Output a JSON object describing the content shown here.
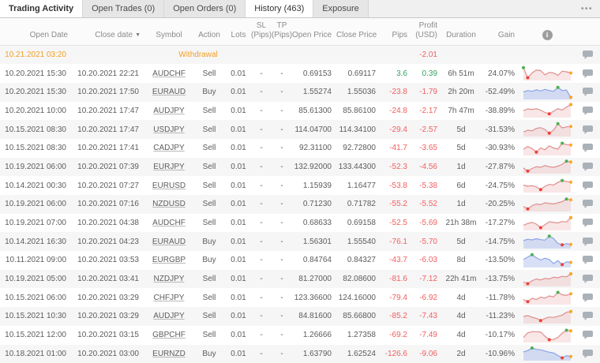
{
  "tabs": [
    {
      "label": "Trading Activity",
      "variant": "title",
      "active": false
    },
    {
      "label": "Open Trades (0)",
      "active": false
    },
    {
      "label": "Open Orders (0)",
      "active": false
    },
    {
      "label": "History (463)",
      "active": true
    },
    {
      "label": "Exposure",
      "active": false
    }
  ],
  "menu_icon": "ellipsis-menu",
  "header_info_icon": "i",
  "columns": [
    {
      "key": "open_date",
      "label": "Open Date",
      "width": 92,
      "align": "r"
    },
    {
      "key": "close_date",
      "label": "Close date",
      "width": 92,
      "align": "r",
      "sorted": "desc",
      "sort_glyph": "▼"
    },
    {
      "key": "symbol",
      "label": "Symbol",
      "width": 60,
      "align": "c"
    },
    {
      "key": "action",
      "label": "Action",
      "width": 42,
      "align": "c"
    },
    {
      "key": "lots",
      "label": "Lots",
      "width": 32,
      "align": "c"
    },
    {
      "key": "sl",
      "label": "SL",
      "label2": "(Pips)",
      "width": 26,
      "align": "c"
    },
    {
      "key": "tp",
      "label": "TP",
      "label2": "(Pips)",
      "width": 26,
      "align": "c"
    },
    {
      "key": "open_price",
      "label": "Open Price",
      "width": 56,
      "align": "r"
    },
    {
      "key": "close_price",
      "label": "Close Price",
      "width": 56,
      "align": "r"
    },
    {
      "key": "pips",
      "label": "Pips",
      "width": 40,
      "align": "r"
    },
    {
      "key": "profit",
      "label": "Profit",
      "label2": "(USD)",
      "width": 38,
      "align": "r"
    },
    {
      "key": "duration",
      "label": "Duration",
      "width": 48,
      "align": "c"
    },
    {
      "key": "gain",
      "label": "Gain",
      "width": 50,
      "align": "r"
    },
    {
      "key": "chart",
      "label": "",
      "width": 70,
      "align": "c",
      "icon": "info"
    },
    {
      "key": "comment",
      "label": "",
      "width": 32,
      "align": "c"
    }
  ],
  "rows": [
    {
      "type": "withdrawal",
      "open_date": "10.21.2021 03:20",
      "label": "Withdrawal",
      "profit": "-2.01"
    },
    {
      "open_date": "10.20.2021 15:30",
      "close_date": "10.20.2021 22:21",
      "symbol": "AUDCHF",
      "action": "Sell",
      "lots": "0.01",
      "sl": "-",
      "tp": "-",
      "open_price": "0.69153",
      "close_price": "0.69117",
      "pips": "3.6",
      "profit": "0.39",
      "duration": "6h 51m",
      "gain": "24.07%",
      "spark": {
        "color": "red",
        "values": [
          0.95,
          0.1,
          0.5,
          0.75,
          0.7,
          0.35,
          0.55,
          0.5,
          0.3,
          0.65,
          0.6,
          0.5
        ]
      }
    },
    {
      "open_date": "10.20.2021 15:30",
      "close_date": "10.20.2021 17:50",
      "symbol": "EURAUD",
      "action": "Buy",
      "lots": "0.01",
      "sl": "-",
      "tp": "-",
      "open_price": "1.55274",
      "close_price": "1.55036",
      "pips": "-23.8",
      "profit": "-1.79",
      "duration": "2h 20m",
      "gain": "-52.49%",
      "spark": {
        "color": "blue",
        "values": [
          0.5,
          0.62,
          0.55,
          0.68,
          0.58,
          0.72,
          0.62,
          0.55,
          0.88,
          0.62,
          0.66,
          0.04
        ]
      }
    },
    {
      "open_date": "10.20.2021 10:00",
      "close_date": "10.20.2021 17:47",
      "symbol": "AUDJPY",
      "action": "Sell",
      "lots": "0.01",
      "sl": "-",
      "tp": "-",
      "open_price": "85.61300",
      "close_price": "85.86100",
      "pips": "-24.8",
      "profit": "-2.17",
      "duration": "7h 47m",
      "gain": "-38.89%",
      "spark": {
        "color": "red",
        "values": [
          0.45,
          0.6,
          0.55,
          0.62,
          0.5,
          0.3,
          0.18,
          0.4,
          0.62,
          0.5,
          0.75,
          0.97
        ]
      }
    },
    {
      "open_date": "10.15.2021 08:30",
      "close_date": "10.20.2021 17:47",
      "symbol": "USDJPY",
      "action": "Sell",
      "lots": "0.01",
      "sl": "-",
      "tp": "-",
      "open_price": "114.04700",
      "close_price": "114.34100",
      "pips": "-29.4",
      "profit": "-2.57",
      "duration": "5d",
      "gain": "-31.53%",
      "spark": {
        "color": "red",
        "values": [
          0.25,
          0.4,
          0.35,
          0.55,
          0.62,
          0.45,
          0.15,
          0.4,
          0.95,
          0.6,
          0.68,
          0.72
        ]
      }
    },
    {
      "open_date": "10.15.2021 08:30",
      "close_date": "10.20.2021 17:41",
      "symbol": "CADJPY",
      "action": "Sell",
      "lots": "0.01",
      "sl": "-",
      "tp": "-",
      "open_price": "92.31100",
      "close_price": "92.72800",
      "pips": "-41.7",
      "profit": "-3.65",
      "duration": "5d",
      "gain": "-30.93%",
      "spark": {
        "color": "red",
        "values": [
          0.4,
          0.62,
          0.45,
          0.15,
          0.5,
          0.35,
          0.68,
          0.5,
          0.4,
          0.9,
          0.78,
          0.75
        ]
      }
    },
    {
      "open_date": "10.19.2021 06:00",
      "close_date": "10.20.2021 07:39",
      "symbol": "EURJPY",
      "action": "Sell",
      "lots": "0.01",
      "sl": "-",
      "tp": "-",
      "open_price": "132.92000",
      "close_price": "133.44300",
      "pips": "-52.3",
      "profit": "-4.56",
      "duration": "1d",
      "gain": "-27.87%",
      "spark": {
        "color": "red",
        "values": [
          0.35,
          0.08,
          0.3,
          0.45,
          0.4,
          0.55,
          0.45,
          0.4,
          0.5,
          0.65,
          0.92,
          0.85
        ]
      }
    },
    {
      "open_date": "10.14.2021 00:30",
      "close_date": "10.20.2021 07:27",
      "symbol": "EURUSD",
      "action": "Sell",
      "lots": "0.01",
      "sl": "-",
      "tp": "-",
      "open_price": "1.15939",
      "close_price": "1.16477",
      "pips": "-53.8",
      "profit": "-5.38",
      "duration": "6d",
      "gain": "-24.75%",
      "spark": {
        "color": "red",
        "values": [
          0.5,
          0.4,
          0.45,
          0.35,
          0.12,
          0.4,
          0.55,
          0.5,
          0.72,
          0.88,
          0.8,
          0.75
        ]
      }
    },
    {
      "open_date": "10.19.2021 06:00",
      "close_date": "10.20.2021 07:16",
      "symbol": "NZDUSD",
      "action": "Sell",
      "lots": "0.01",
      "sl": "-",
      "tp": "-",
      "open_price": "0.71230",
      "close_price": "0.71782",
      "pips": "-55.2",
      "profit": "-5.52",
      "duration": "1d",
      "gain": "-20.25%",
      "spark": {
        "color": "red",
        "values": [
          0.3,
          0.08,
          0.35,
          0.5,
          0.45,
          0.6,
          0.55,
          0.5,
          0.6,
          0.7,
          0.92,
          0.85
        ]
      }
    },
    {
      "open_date": "10.19.2021 07:00",
      "close_date": "10.20.2021 04:38",
      "symbol": "AUDCHF",
      "action": "Sell",
      "lots": "0.01",
      "sl": "-",
      "tp": "-",
      "open_price": "0.68633",
      "close_price": "0.69158",
      "pips": "-52.5",
      "profit": "-5.69",
      "duration": "21h 38m",
      "gain": "-17.27%",
      "spark": {
        "color": "red",
        "values": [
          0.3,
          0.45,
          0.55,
          0.4,
          0.1,
          0.35,
          0.6,
          0.55,
          0.5,
          0.62,
          0.58,
          0.95
        ]
      }
    },
    {
      "open_date": "10.14.2021 16:30",
      "close_date": "10.20.2021 04:23",
      "symbol": "EURAUD",
      "action": "Buy",
      "lots": "0.01",
      "sl": "-",
      "tp": "-",
      "open_price": "1.56301",
      "close_price": "1.55540",
      "pips": "-76.1",
      "profit": "-5.70",
      "duration": "5d",
      "gain": "-14.75%",
      "spark": {
        "color": "blue",
        "values": [
          0.55,
          0.65,
          0.6,
          0.7,
          0.62,
          0.58,
          0.92,
          0.72,
          0.3,
          0.18,
          0.28,
          0.22
        ]
      }
    },
    {
      "open_date": "10.11.2021 09:00",
      "close_date": "10.20.2021 03:53",
      "symbol": "EURGBP",
      "action": "Buy",
      "lots": "0.01",
      "sl": "-",
      "tp": "-",
      "open_price": "0.84764",
      "close_price": "0.84327",
      "pips": "-43.7",
      "profit": "-6.03",
      "duration": "8d",
      "gain": "-13.50%",
      "spark": {
        "color": "blue",
        "values": [
          0.55,
          0.75,
          0.95,
          0.7,
          0.5,
          0.65,
          0.55,
          0.2,
          0.45,
          0.12,
          0.35,
          0.3
        ]
      }
    },
    {
      "open_date": "10.19.2021 05:00",
      "close_date": "10.20.2021 03:41",
      "symbol": "NZDJPY",
      "action": "Sell",
      "lots": "0.01",
      "sl": "-",
      "tp": "-",
      "open_price": "81.27000",
      "close_price": "82.08600",
      "pips": "-81.6",
      "profit": "-7.12",
      "duration": "22h 41m",
      "gain": "-13.75%",
      "spark": {
        "color": "red",
        "values": [
          0.25,
          0.1,
          0.35,
          0.5,
          0.42,
          0.55,
          0.5,
          0.65,
          0.6,
          0.72,
          0.68,
          0.93
        ]
      }
    },
    {
      "open_date": "10.15.2021 06:00",
      "close_date": "10.20.2021 03:29",
      "symbol": "CHFJPY",
      "action": "Sell",
      "lots": "0.01",
      "sl": "-",
      "tp": "-",
      "open_price": "123.36600",
      "close_price": "124.16000",
      "pips": "-79.4",
      "profit": "-6.92",
      "duration": "4d",
      "gain": "-11.78%",
      "spark": {
        "color": "red",
        "values": [
          0.3,
          0.12,
          0.4,
          0.3,
          0.5,
          0.42,
          0.6,
          0.52,
          0.9,
          0.7,
          0.65,
          0.78
        ]
      }
    },
    {
      "open_date": "10.15.2021 10:30",
      "close_date": "10.20.2021 03:29",
      "symbol": "AUDJPY",
      "action": "Sell",
      "lots": "0.01",
      "sl": "-",
      "tp": "-",
      "open_price": "84.81600",
      "close_price": "85.66800",
      "pips": "-85.2",
      "profit": "-7.43",
      "duration": "4d",
      "gain": "-11.23%",
      "spark": {
        "color": "red",
        "values": [
          0.45,
          0.55,
          0.4,
          0.3,
          0.12,
          0.3,
          0.42,
          0.38,
          0.48,
          0.58,
          0.82,
          0.88
        ]
      }
    },
    {
      "open_date": "10.15.2021 12:00",
      "close_date": "10.20.2021 03:15",
      "symbol": "GBPCHF",
      "action": "Sell",
      "lots": "0.01",
      "sl": "-",
      "tp": "-",
      "open_price": "1.26666",
      "close_price": "1.27358",
      "pips": "-69.2",
      "profit": "-7.49",
      "duration": "4d",
      "gain": "-10.17%",
      "spark": {
        "color": "red",
        "values": [
          0.3,
          0.68,
          0.78,
          0.78,
          0.75,
          0.4,
          0.1,
          0.12,
          0.3,
          0.65,
          0.9,
          0.85
        ]
      }
    },
    {
      "open_date": "10.18.2021 01:00",
      "close_date": "10.20.2021 03:00",
      "symbol": "EURNZD",
      "action": "Buy",
      "lots": "0.01",
      "sl": "-",
      "tp": "-",
      "open_price": "1.63790",
      "close_price": "1.62524",
      "pips": "-126.6",
      "profit": "-9.06",
      "duration": "2d",
      "gain": "-10.96%",
      "spark": {
        "color": "blue",
        "values": [
          0.6,
          0.72,
          0.93,
          0.82,
          0.78,
          0.68,
          0.58,
          0.52,
          0.3,
          0.1,
          0.28,
          0.22
        ]
      }
    }
  ],
  "colors": {
    "orange": "#f2a024",
    "green_text": "#31a05f",
    "red_text": "#f25e5e",
    "spark_red_line": "#df8f8f",
    "spark_red_fill": "rgba(226,140,140,0.22)",
    "spark_blue_line": "#8aa4e6",
    "spark_blue_fill": "rgba(140,165,230,0.35)",
    "dot_green": "#4caf50",
    "dot_red": "#ef4035",
    "dot_orange": "#ffa726",
    "comment_icon": "#aab1b8"
  }
}
